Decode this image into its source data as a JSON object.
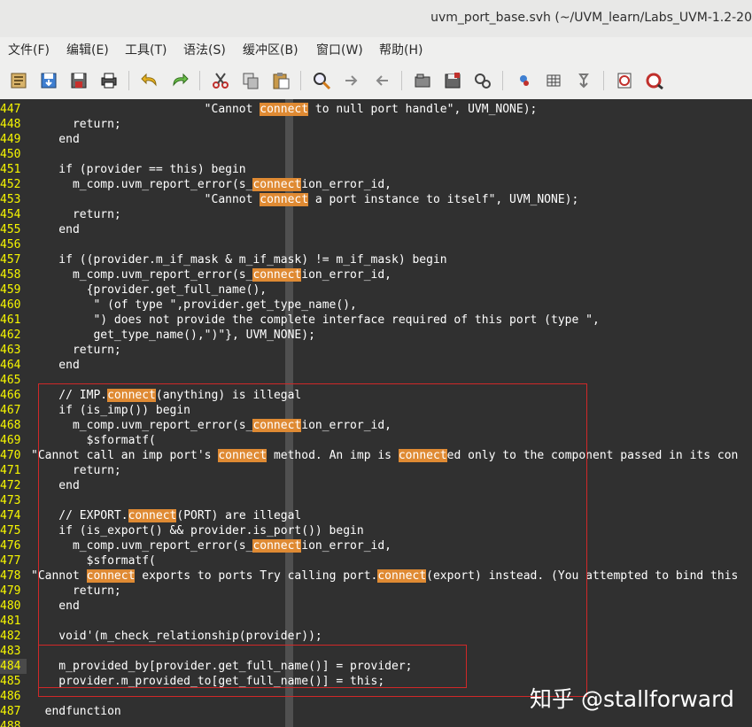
{
  "window": {
    "title": "uvm_port_base.svh (~/UVM_learn/Labs_UVM-1.2-20"
  },
  "menu": [
    "文件(F)",
    "编辑(E)",
    "工具(T)",
    "语法(S)",
    "缓冲区(B)",
    "窗口(W)",
    "帮助(H)"
  ],
  "toolbar": {
    "buttons": [
      {
        "icon": "open-file-icon"
      },
      {
        "icon": "save-icon"
      },
      {
        "icon": "save-all-icon"
      },
      {
        "icon": "print-icon"
      },
      {
        "icon": "undo-icon"
      },
      {
        "icon": "redo-icon"
      },
      {
        "icon": "cut-icon"
      },
      {
        "icon": "copy-icon"
      },
      {
        "icon": "paste-icon"
      },
      {
        "icon": "find-replace-icon"
      },
      {
        "icon": "find-next-icon"
      },
      {
        "icon": "find-previous-icon"
      },
      {
        "icon": "load-session-icon"
      },
      {
        "icon": "save-session-icon"
      },
      {
        "icon": "run-script-icon"
      },
      {
        "icon": "make-icon"
      },
      {
        "icon": "run-ctags-icon"
      },
      {
        "icon": "jump-tag-icon"
      },
      {
        "icon": "help-icon"
      },
      {
        "icon": "find-help-icon"
      }
    ]
  },
  "colors": {
    "line_number": "#f6f600",
    "search_highlight": "#df8a33",
    "annotation_box": "#d02828",
    "editor_bg": "#303030"
  },
  "editor": {
    "lines": [
      {
        "n": "447",
        "segs": [
          {
            "t": "                         \"Cannot "
          },
          {
            "t": "connect",
            "hl": true
          },
          {
            "t": " to null port handle\", UVM_NONE);"
          }
        ]
      },
      {
        "n": "448",
        "segs": [
          {
            "t": "      return;"
          }
        ]
      },
      {
        "n": "449",
        "segs": [
          {
            "t": "    end"
          }
        ]
      },
      {
        "n": "450",
        "segs": [
          {
            "t": ""
          }
        ]
      },
      {
        "n": "451",
        "segs": [
          {
            "t": "    if (provider == this) begin"
          }
        ]
      },
      {
        "n": "452",
        "segs": [
          {
            "t": "      m_comp.uvm_report_error(s_"
          },
          {
            "t": "connect",
            "hl": true
          },
          {
            "t": "ion_error_id,"
          }
        ]
      },
      {
        "n": "453",
        "segs": [
          {
            "t": "                         \"Cannot "
          },
          {
            "t": "connect",
            "hl": true
          },
          {
            "t": " a port instance to itself\", UVM_NONE);"
          }
        ]
      },
      {
        "n": "454",
        "segs": [
          {
            "t": "      return;"
          }
        ]
      },
      {
        "n": "455",
        "segs": [
          {
            "t": "    end"
          }
        ]
      },
      {
        "n": "456",
        "segs": [
          {
            "t": ""
          }
        ]
      },
      {
        "n": "457",
        "segs": [
          {
            "t": "    if ((provider.m_if_mask & m_if_mask) != m_if_mask) begin"
          }
        ]
      },
      {
        "n": "458",
        "segs": [
          {
            "t": "      m_comp.uvm_report_error(s_"
          },
          {
            "t": "connect",
            "hl": true
          },
          {
            "t": "ion_error_id,"
          }
        ]
      },
      {
        "n": "459",
        "segs": [
          {
            "t": "        {provider.get_full_name(),"
          }
        ]
      },
      {
        "n": "460",
        "segs": [
          {
            "t": "         \" (of type \",provider.get_type_name(),"
          }
        ]
      },
      {
        "n": "461",
        "segs": [
          {
            "t": "         \") does not provide the complete interface required of this port (type \","
          }
        ]
      },
      {
        "n": "462",
        "segs": [
          {
            "t": "         get_type_name(),\")\"}, UVM_NONE);"
          }
        ]
      },
      {
        "n": "463",
        "segs": [
          {
            "t": "      return;"
          }
        ]
      },
      {
        "n": "464",
        "segs": [
          {
            "t": "    end"
          }
        ]
      },
      {
        "n": "465",
        "segs": [
          {
            "t": ""
          }
        ]
      },
      {
        "n": "466",
        "segs": [
          {
            "t": "    // IMP."
          },
          {
            "t": "connect",
            "hl": true
          },
          {
            "t": "(anything) is illegal"
          }
        ]
      },
      {
        "n": "467",
        "segs": [
          {
            "t": "    if (is_imp()) begin"
          }
        ]
      },
      {
        "n": "468",
        "segs": [
          {
            "t": "      m_comp.uvm_report_error(s_"
          },
          {
            "t": "connect",
            "hl": true
          },
          {
            "t": "ion_error_id,"
          }
        ]
      },
      {
        "n": "469",
        "segs": [
          {
            "t": "        $sformatf("
          }
        ]
      },
      {
        "n": "470",
        "segs": [
          {
            "t": "\"Cannot call an imp port's "
          },
          {
            "t": "connect",
            "hl": true
          },
          {
            "t": " method. An imp is "
          },
          {
            "t": "connect",
            "hl": true
          },
          {
            "t": "ed only to the component passed in its con"
          }
        ]
      },
      {
        "n": "471",
        "segs": [
          {
            "t": "      return;"
          }
        ]
      },
      {
        "n": "472",
        "segs": [
          {
            "t": "    end"
          }
        ]
      },
      {
        "n": "473",
        "segs": [
          {
            "t": ""
          }
        ]
      },
      {
        "n": "474",
        "segs": [
          {
            "t": "    // EXPORT."
          },
          {
            "t": "connect",
            "hl": true
          },
          {
            "t": "(PORT) are illegal"
          }
        ]
      },
      {
        "n": "475",
        "segs": [
          {
            "t": "    if (is_export() && provider.is_port()) begin"
          }
        ]
      },
      {
        "n": "476",
        "segs": [
          {
            "t": "      m_comp.uvm_report_error(s_"
          },
          {
            "t": "connect",
            "hl": true
          },
          {
            "t": "ion_error_id,"
          }
        ]
      },
      {
        "n": "477",
        "segs": [
          {
            "t": "        $sformatf("
          }
        ]
      },
      {
        "n": "478",
        "segs": [
          {
            "t": "\"Cannot "
          },
          {
            "t": "connect",
            "hl": true
          },
          {
            "t": " exports to ports Try calling port."
          },
          {
            "t": "connect",
            "hl": true
          },
          {
            "t": "(export) instead. (You attempted to bind this"
          }
        ]
      },
      {
        "n": "479",
        "segs": [
          {
            "t": "      return;"
          }
        ]
      },
      {
        "n": "480",
        "segs": [
          {
            "t": "    end"
          }
        ]
      },
      {
        "n": "481",
        "segs": [
          {
            "t": ""
          }
        ]
      },
      {
        "n": "482",
        "segs": [
          {
            "t": "    void'(m_check_relationship(provider));"
          }
        ]
      },
      {
        "n": "483",
        "segs": [
          {
            "t": ""
          }
        ]
      },
      {
        "n": "484",
        "cur": true,
        "segs": [
          {
            "t": "    m_provided_by[provider.get_full_name()] = provider;"
          }
        ]
      },
      {
        "n": "485",
        "segs": [
          {
            "t": "    provider.m_provided_to[get_full_name()] = this;"
          }
        ]
      },
      {
        "n": "486",
        "segs": [
          {
            "t": ""
          }
        ]
      },
      {
        "n": "487",
        "segs": [
          {
            "t": "  endfunction"
          }
        ]
      },
      {
        "n": "488",
        "segs": [
          {
            "t": ""
          }
        ]
      }
    ]
  },
  "watermark": "知乎 @stallforward"
}
